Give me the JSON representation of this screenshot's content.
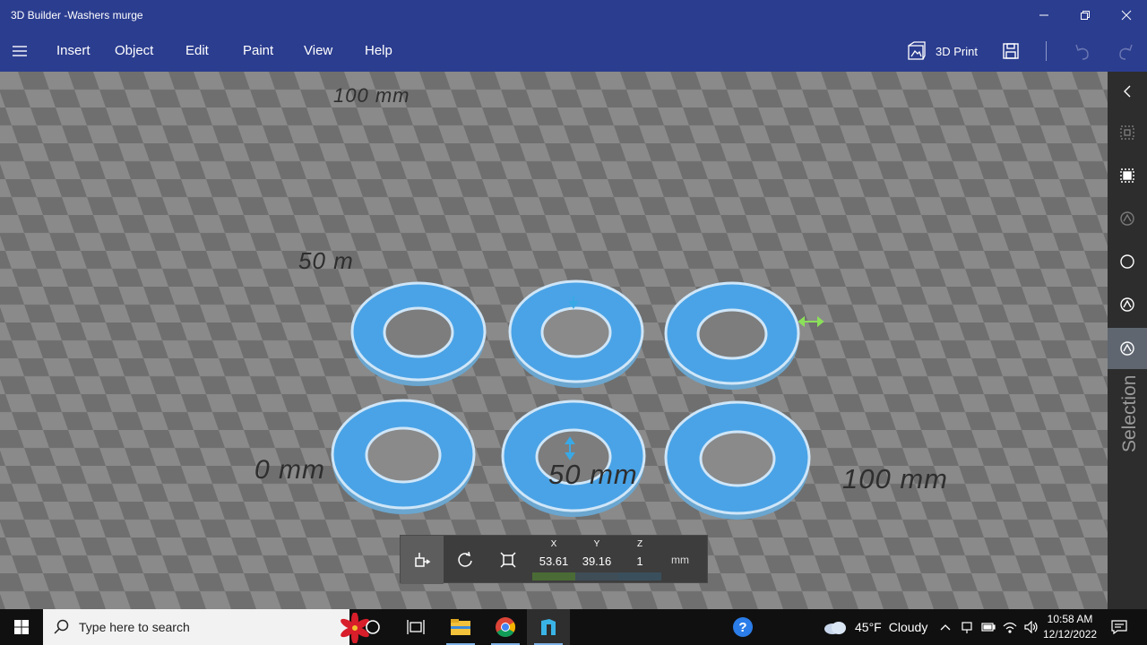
{
  "window": {
    "title": "3D Builder -Washers murge"
  },
  "menu": {
    "items": [
      "Insert",
      "Object",
      "Edit",
      "Paint",
      "View",
      "Help"
    ],
    "print_label": "3D Print"
  },
  "viewport": {
    "axis_labels": {
      "top": "100 mm",
      "left": "50 m",
      "origin": "0 mm",
      "mid": "50 mm",
      "right": "100 mm"
    },
    "object_color": "#4aa3e6"
  },
  "side_panel": {
    "label": "Selection"
  },
  "coords": {
    "x_label": "X",
    "x_value": "53.61",
    "y_label": "Y",
    "y_value": "39.16",
    "z_label": "Z",
    "z_value": "1",
    "unit": "mm"
  },
  "taskbar": {
    "search_placeholder": "Type here to search",
    "weather_temp": "45°F",
    "weather_text": "Cloudy",
    "time": "10:58 AM",
    "date": "12/12/2022"
  }
}
